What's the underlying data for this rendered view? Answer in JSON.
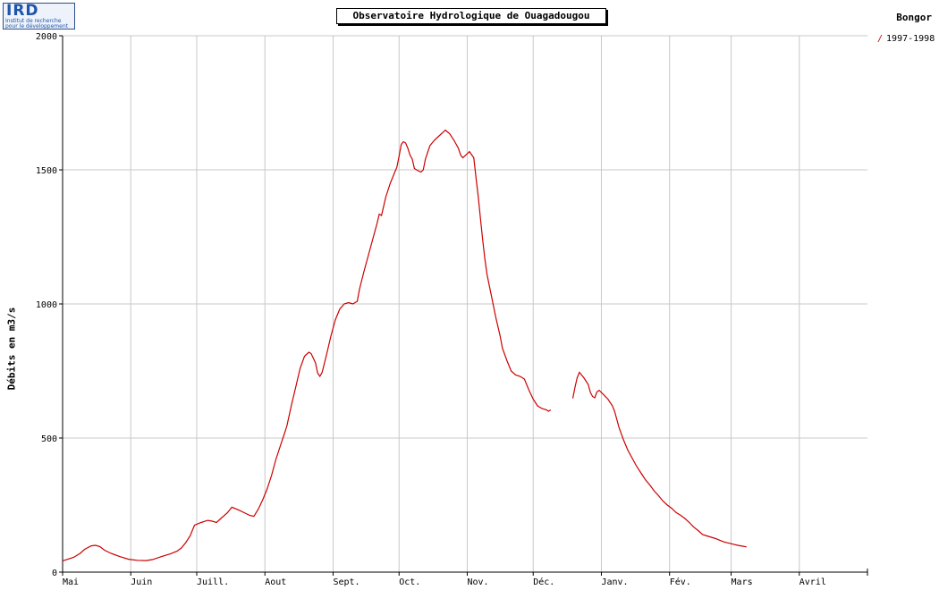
{
  "logo": {
    "text": "IRD",
    "line1": "Institut de recherche",
    "line2": "pour le développement"
  },
  "chart_data": {
    "type": "line",
    "title": "Observatoire Hydrologique de Ouagadougou",
    "station": "Bongor",
    "ylabel": "Débits en m3/s",
    "xlabel": "",
    "ylim": [
      0,
      2000
    ],
    "yticks": [
      0,
      500,
      1000,
      1500,
      2000
    ],
    "x_day_range": [
      0,
      366
    ],
    "months": [
      {
        "label": "Mai",
        "day": 0
      },
      {
        "label": "Juin",
        "day": 31
      },
      {
        "label": "Juill.",
        "day": 61
      },
      {
        "label": "Aout",
        "day": 92
      },
      {
        "label": "Sept.",
        "day": 123
      },
      {
        "label": "Oct.",
        "day": 153
      },
      {
        "label": "Nov.",
        "day": 184
      },
      {
        "label": "Déc.",
        "day": 214
      },
      {
        "label": "Janv.",
        "day": 245
      },
      {
        "label": "Fév.",
        "day": 276
      },
      {
        "label": "Mars",
        "day": 304
      },
      {
        "label": "Avril",
        "day": 335
      }
    ],
    "grid": true,
    "legend_position": "right",
    "color": "#cc0000",
    "series": [
      {
        "name": "1997-1998",
        "segments": [
          [
            [
              0,
              42
            ],
            [
              5,
              55
            ],
            [
              8,
              70
            ],
            [
              10,
              85
            ],
            [
              13,
              98
            ],
            [
              15,
              100
            ],
            [
              17,
              95
            ],
            [
              19,
              82
            ],
            [
              22,
              70
            ],
            [
              26,
              58
            ],
            [
              30,
              48
            ],
            [
              34,
              44
            ],
            [
              38,
              43
            ],
            [
              41,
              47
            ],
            [
              45,
              58
            ],
            [
              49,
              68
            ],
            [
              52,
              78
            ],
            [
              54,
              90
            ],
            [
              56,
              110
            ],
            [
              58,
              135
            ],
            [
              60,
              175
            ],
            [
              63,
              185
            ],
            [
              66,
              193
            ],
            [
              68,
              190
            ],
            [
              70,
              185
            ],
            [
              72,
              200
            ],
            [
              75,
              222
            ],
            [
              77,
              242
            ],
            [
              80,
              232
            ],
            [
              83,
              220
            ],
            [
              85,
              212
            ],
            [
              87,
              208
            ],
            [
              89,
              235
            ],
            [
              91,
              270
            ],
            [
              93,
              310
            ],
            [
              95,
              360
            ],
            [
              97,
              420
            ],
            [
              99,
              470
            ],
            [
              101,
              520
            ],
            [
              102,
              545
            ],
            [
              104,
              620
            ],
            [
              106,
              690
            ],
            [
              108,
              760
            ],
            [
              110,
              805
            ],
            [
              112,
              820
            ],
            [
              113,
              815
            ],
            [
              115,
              780
            ],
            [
              116,
              742
            ],
            [
              117,
              730
            ],
            [
              118,
              745
            ],
            [
              120,
              810
            ],
            [
              122,
              880
            ],
            [
              124,
              940
            ],
            [
              126,
              980
            ],
            [
              128,
              1000
            ],
            [
              130,
              1005
            ],
            [
              132,
              1000
            ],
            [
              134,
              1010
            ],
            [
              135,
              1055
            ],
            [
              137,
              1120
            ],
            [
              139,
              1180
            ],
            [
              141,
              1240
            ],
            [
              143,
              1300
            ],
            [
              144,
              1335
            ],
            [
              145,
              1330
            ],
            [
              147,
              1400
            ],
            [
              149,
              1450
            ],
            [
              151,
              1490
            ],
            [
              152,
              1510
            ],
            [
              153,
              1550
            ],
            [
              154,
              1595
            ],
            [
              155,
              1605
            ],
            [
              156,
              1600
            ],
            [
              157,
              1580
            ],
            [
              158,
              1555
            ],
            [
              159,
              1540
            ],
            [
              160,
              1505
            ],
            [
              161,
              1500
            ],
            [
              162,
              1495
            ],
            [
              163,
              1492
            ],
            [
              164,
              1500
            ],
            [
              165,
              1540
            ],
            [
              167,
              1590
            ],
            [
              169,
              1610
            ],
            [
              171,
              1625
            ],
            [
              173,
              1640
            ],
            [
              174,
              1648
            ],
            [
              176,
              1635
            ],
            [
              178,
              1610
            ],
            [
              180,
              1580
            ],
            [
              181,
              1555
            ],
            [
              182,
              1545
            ],
            [
              184,
              1560
            ],
            [
              185,
              1568
            ],
            [
              187,
              1545
            ],
            [
              188,
              1470
            ],
            [
              189,
              1400
            ],
            [
              190,
              1320
            ],
            [
              191,
              1240
            ],
            [
              192,
              1170
            ],
            [
              193,
              1110
            ],
            [
              195,
              1030
            ],
            [
              197,
              950
            ],
            [
              199,
              880
            ],
            [
              200,
              835
            ],
            [
              202,
              790
            ],
            [
              204,
              750
            ],
            [
              206,
              735
            ],
            [
              208,
              730
            ],
            [
              210,
              720
            ],
            [
              212,
              680
            ],
            [
              214,
              645
            ],
            [
              216,
              620
            ],
            [
              218,
              610
            ],
            [
              220,
              605
            ],
            [
              221,
              600
            ],
            [
              222,
              605
            ]
          ],
          [
            [
              232,
              648
            ],
            [
              233,
              690
            ],
            [
              234,
              725
            ],
            [
              235,
              745
            ],
            [
              237,
              725
            ],
            [
              239,
              700
            ],
            [
              240,
              670
            ],
            [
              241,
              655
            ],
            [
              242,
              650
            ],
            [
              243,
              672
            ],
            [
              244,
              678
            ],
            [
              246,
              662
            ],
            [
              248,
              645
            ],
            [
              250,
              620
            ],
            [
              251,
              600
            ],
            [
              252,
              570
            ],
            [
              253,
              540
            ],
            [
              255,
              495
            ],
            [
              257,
              455
            ],
            [
              259,
              425
            ],
            [
              261,
              395
            ],
            [
              263,
              370
            ],
            [
              265,
              345
            ],
            [
              267,
              325
            ],
            [
              269,
              303
            ],
            [
              271,
              285
            ],
            [
              273,
              265
            ],
            [
              275,
              250
            ],
            [
              277,
              238
            ],
            [
              279,
              222
            ],
            [
              281,
              212
            ],
            [
              283,
              200
            ],
            [
              285,
              185
            ],
            [
              287,
              168
            ],
            [
              289,
              155
            ],
            [
              291,
              140
            ],
            [
              293,
              135
            ],
            [
              295,
              130
            ],
            [
              297,
              125
            ],
            [
              299,
              118
            ],
            [
              301,
              112
            ],
            [
              303,
              108
            ],
            [
              305,
              104
            ],
            [
              307,
              100
            ],
            [
              309,
              97
            ],
            [
              311,
              94
            ]
          ]
        ]
      }
    ]
  }
}
